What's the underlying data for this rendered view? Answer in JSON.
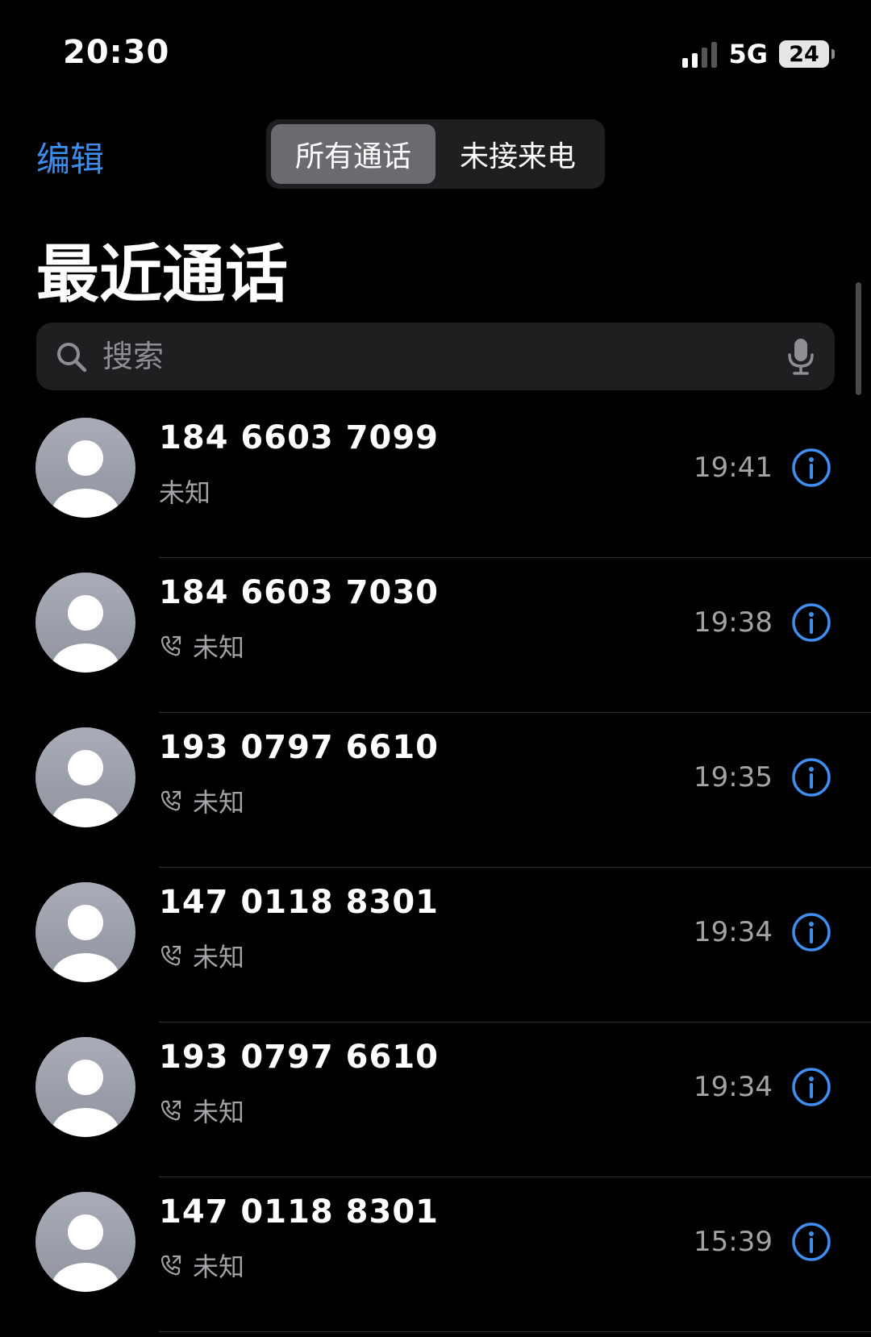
{
  "status_bar": {
    "time": "20:30",
    "network": "5G",
    "battery": "24"
  },
  "nav": {
    "edit_label": "编辑",
    "segments": [
      {
        "label": "所有通话",
        "active": true
      },
      {
        "label": "未接来电",
        "active": false
      }
    ]
  },
  "title": "最近通话",
  "search": {
    "placeholder": "搜索",
    "value": ""
  },
  "calls": [
    {
      "number": "184 6603 7099",
      "label": "未知",
      "time": "19:41",
      "show_phone_icon": false
    },
    {
      "number": "184 6603 7030",
      "label": "未知",
      "time": "19:38",
      "show_phone_icon": true
    },
    {
      "number": "193 0797 6610",
      "label": "未知",
      "time": "19:35",
      "show_phone_icon": true
    },
    {
      "number": "147 0118 8301",
      "label": "未知",
      "time": "19:34",
      "show_phone_icon": true
    },
    {
      "number": "193 0797 6610",
      "label": "未知",
      "time": "19:34",
      "show_phone_icon": true
    },
    {
      "number": "147 0118 8301",
      "label": "未知",
      "time": "15:39",
      "show_phone_icon": true
    }
  ],
  "colors": {
    "accent": "#3e8ef0",
    "secondary_text": "#a3a3a8",
    "background": "#000000"
  },
  "icons": {
    "search": "magnifier-icon",
    "mic": "microphone-icon",
    "avatar": "person-silhouette-icon",
    "outgoing": "phone-outgoing-icon",
    "info": "info-circle-icon"
  }
}
